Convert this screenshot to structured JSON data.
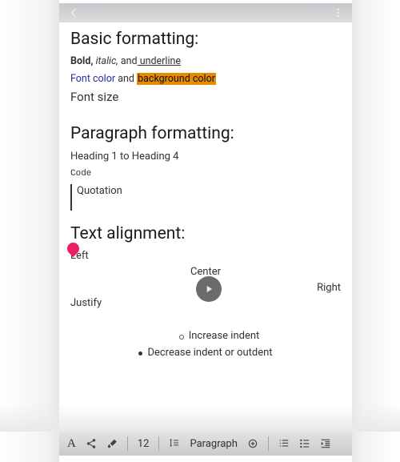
{
  "sections": {
    "basic": "Basic formatting:",
    "paragraph": "Paragraph formatting:",
    "alignment": "Text alignment:"
  },
  "basic": {
    "bold": "Bold,",
    "italic": "italic,",
    "and": "and",
    "underline": " underline",
    "fontcolor": "Font color",
    "and2": "and",
    "bgcolor": "background color",
    "fontsize": "Font size"
  },
  "paragraph": {
    "headings": "Heading 1 to Heading 4",
    "code": "Code",
    "quotation": "Quotation"
  },
  "align": {
    "left": "Left",
    "center": "Center",
    "right": "Right",
    "justify": "Justify"
  },
  "indent": {
    "increase": "Increase indent",
    "decrease": "Decrease indent or outdent"
  },
  "toolbar": {
    "fontsize": "12",
    "style": "Paragraph"
  }
}
